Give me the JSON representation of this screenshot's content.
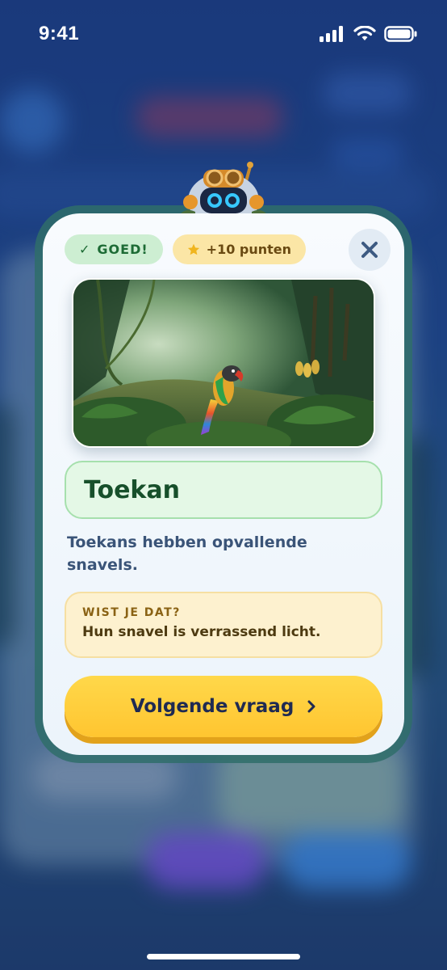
{
  "status_bar": {
    "time": "9:41",
    "icons": [
      "signal-icon",
      "wifi-icon",
      "battery-icon"
    ]
  },
  "result": {
    "correct_icon": "✓",
    "correct_label": "GOED!",
    "points_icon": "star-icon",
    "points_label": "+10 punten"
  },
  "close_icon": "close-icon",
  "answer": "Toekan",
  "explanation": "Toekans hebben opvallende snavels.",
  "fact": {
    "label": "WIST JE DAT?",
    "text": "Hun snavel is verrassend licht."
  },
  "next_button": {
    "label": "Volgende vraag",
    "icon": "chevron-right-icon"
  },
  "colors": {
    "correct_bg": "#cdeed2",
    "points_bg": "#fbe6a6",
    "answer_bg": "#e4f8e6",
    "fact_bg": "#fdf1cf",
    "button": "#ffc530"
  }
}
